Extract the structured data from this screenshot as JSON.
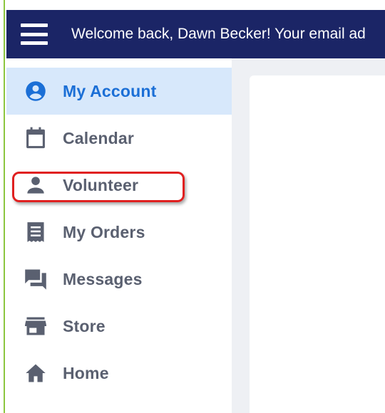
{
  "header": {
    "welcome_text": "Welcome back, Dawn Becker! Your email ad"
  },
  "sidebar": {
    "items": [
      {
        "label": "My Account",
        "icon": "account-circle-icon",
        "active": true
      },
      {
        "label": "Calendar",
        "icon": "calendar-icon",
        "active": false
      },
      {
        "label": "Volunteer",
        "icon": "person-icon",
        "active": false
      },
      {
        "label": "My Orders",
        "icon": "receipt-icon",
        "active": false
      },
      {
        "label": "Messages",
        "icon": "chat-icon",
        "active": false
      },
      {
        "label": "Store",
        "icon": "store-icon",
        "active": false
      },
      {
        "label": "Home",
        "icon": "home-icon",
        "active": false
      }
    ]
  },
  "colors": {
    "topbar": "#1b2566",
    "accent": "#1b6fd6",
    "active_bg": "#d7e8fb",
    "label": "#5a6070",
    "icon": "#5a6070",
    "highlight": "#e02020",
    "left_border": "#8cc63f"
  }
}
